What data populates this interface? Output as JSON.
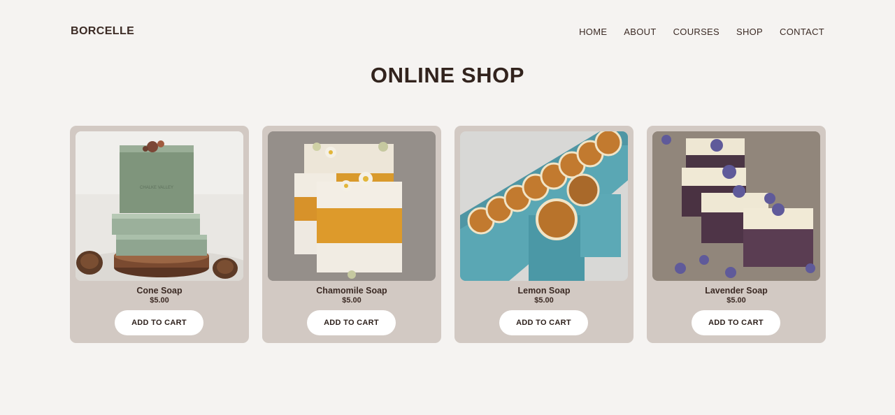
{
  "brand": "BORCELLE",
  "nav": [
    "HOME",
    "ABOUT",
    "COURSES",
    "SHOP",
    "CONTACT"
  ],
  "page_title": "ONLINE SHOP",
  "products": [
    {
      "name": "Cone Soap",
      "price": "$5.00",
      "button": "ADD TO CART",
      "image": "cone-soap-image"
    },
    {
      "name": "Chamomile Soap",
      "price": "$5.00",
      "button": "ADD TO CART",
      "image": "chamomile-soap-image"
    },
    {
      "name": "Lemon Soap",
      "price": "$5.00",
      "button": "ADD TO CART",
      "image": "lemon-soap-image"
    },
    {
      "name": "Lavender Soap",
      "price": "$5.00",
      "button": "ADD TO CART",
      "image": "lavender-soap-image"
    }
  ],
  "colors": {
    "background": "#f5f3f1",
    "card": "#d2c9c3",
    "text": "#3b2a24",
    "button": "#ffffff"
  }
}
